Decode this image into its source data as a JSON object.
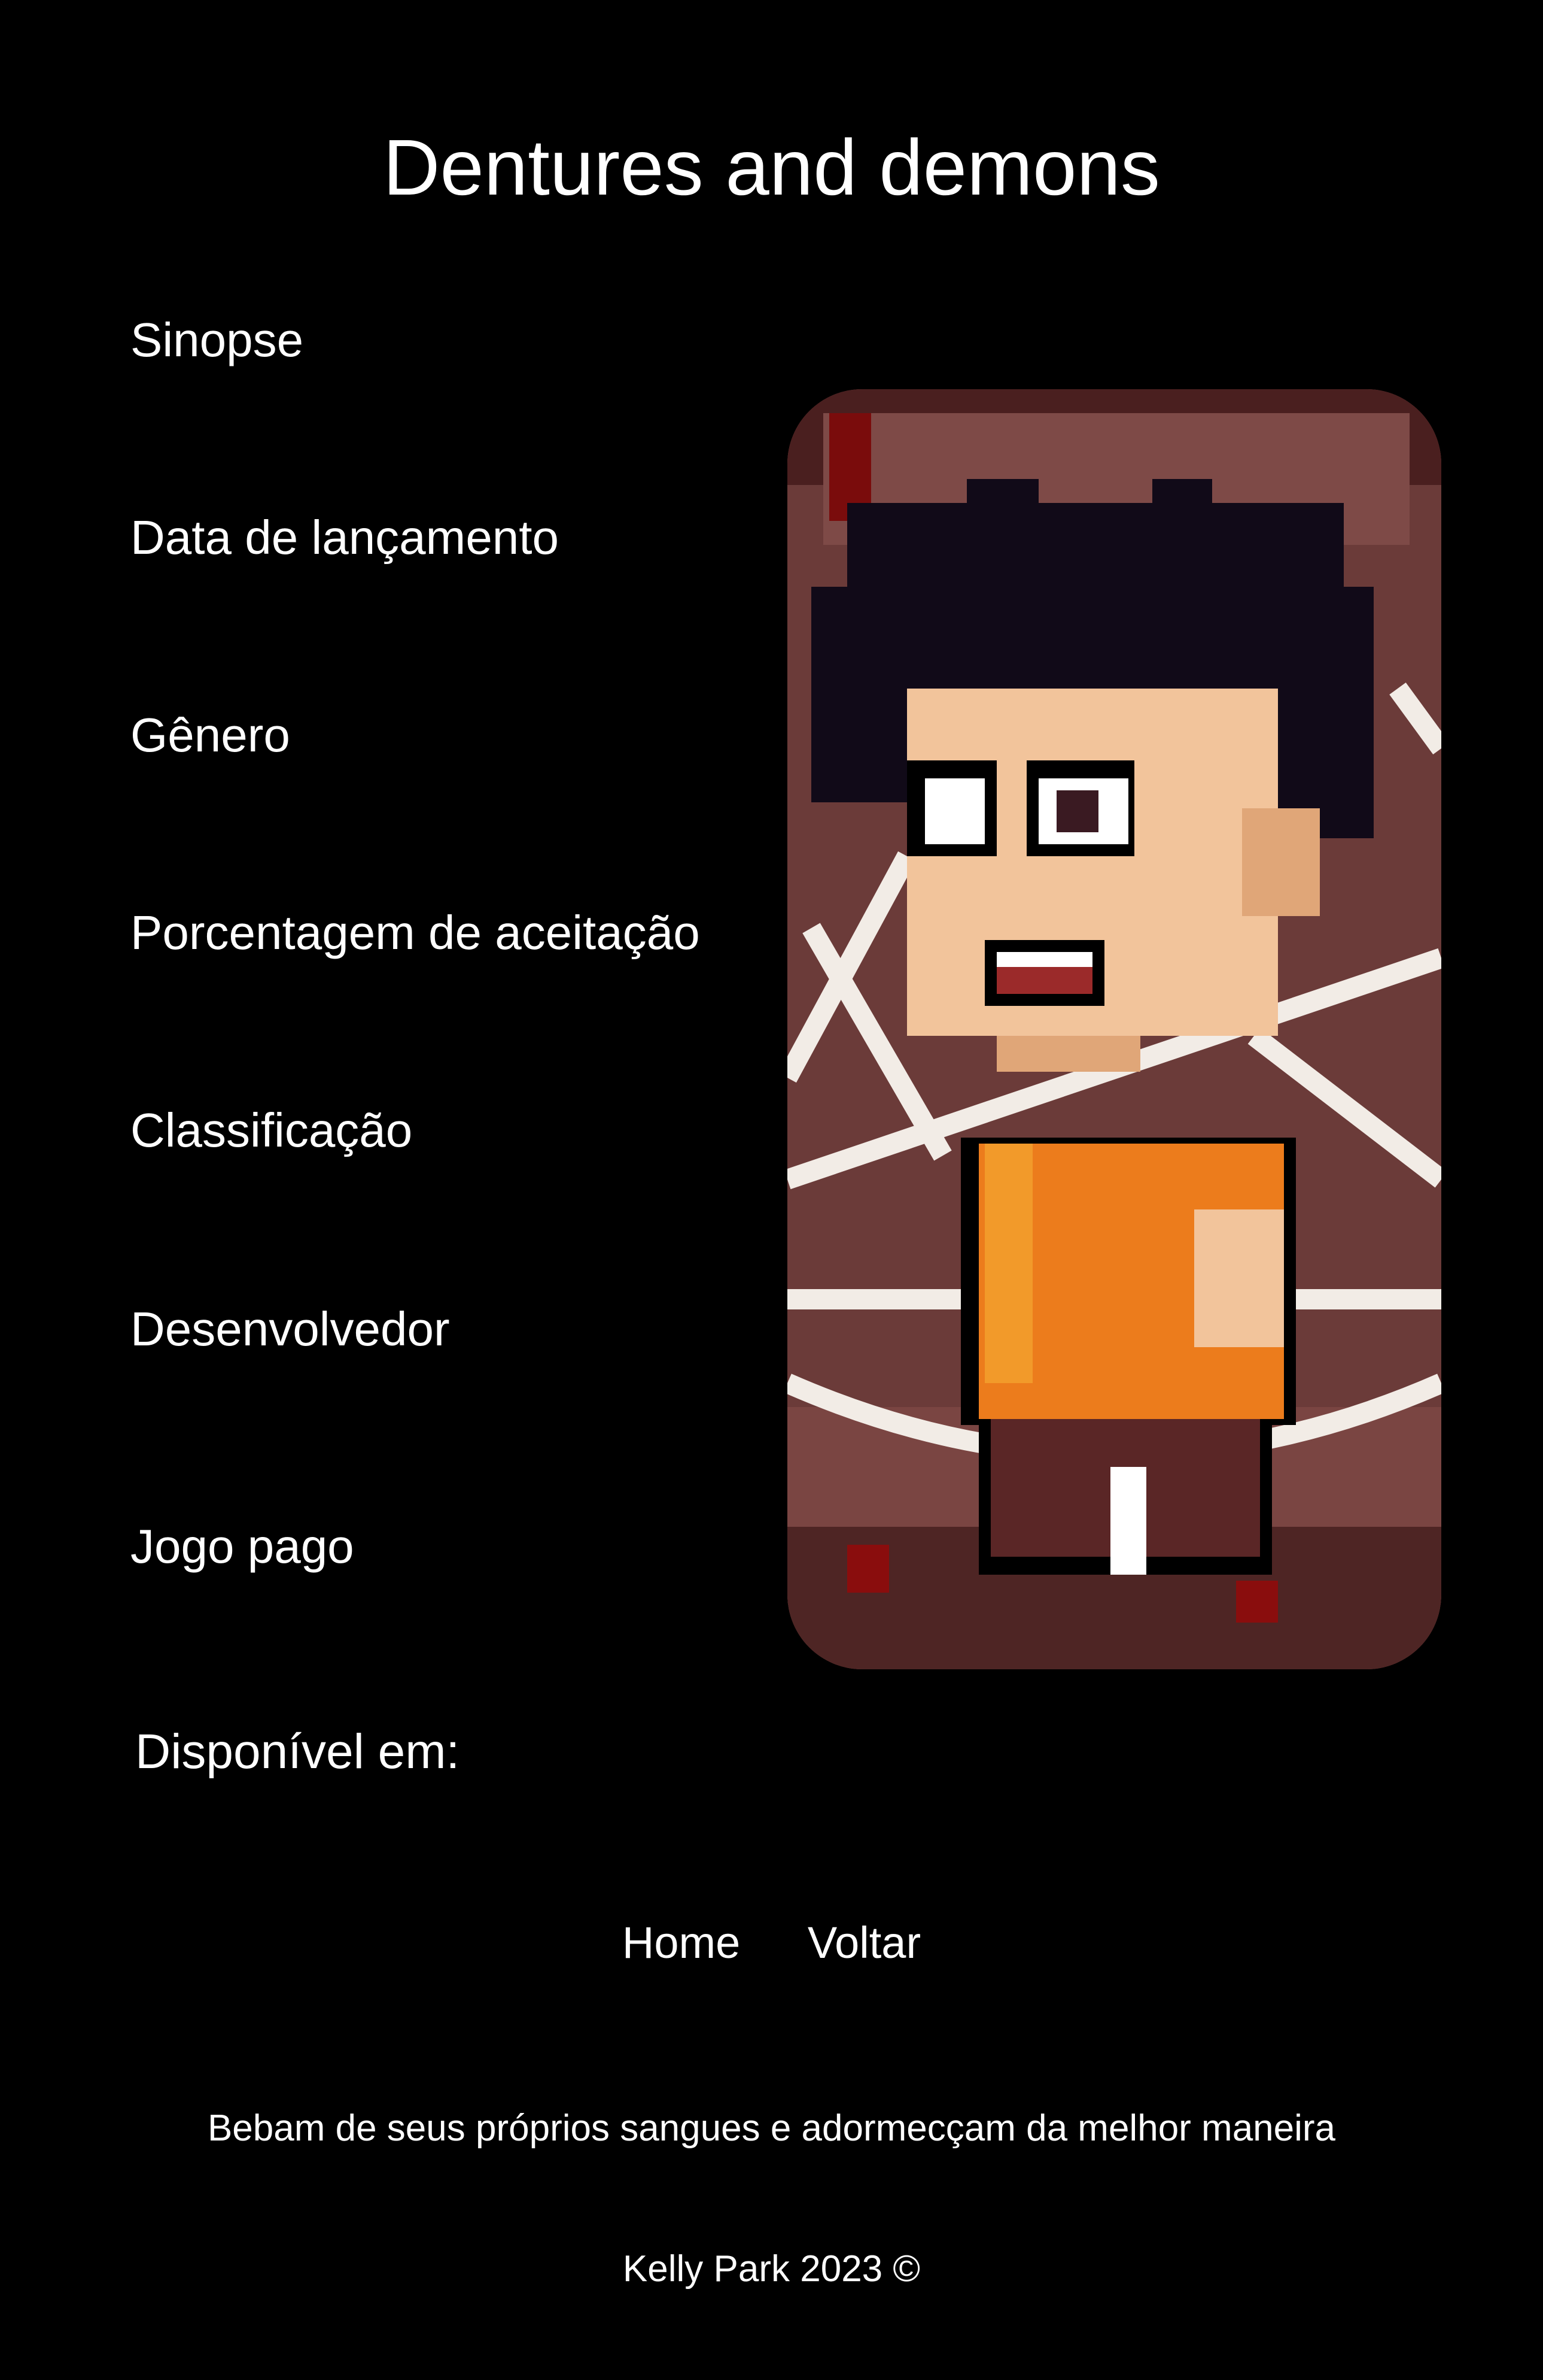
{
  "page": {
    "title": "Dentures and demons"
  },
  "details": {
    "synopsis": "Sinopse",
    "release_date": "Data de lançamento",
    "genre": "Gênero",
    "acceptance": "Porcentagem de aceitação",
    "rating": "Classificação",
    "developer": "Desenvolvedor",
    "paid": "Jogo pago",
    "available_on": "Disponível em:"
  },
  "nav": {
    "home": "Home",
    "back": "Voltar"
  },
  "footer": {
    "tagline": "Bebam de seus próprios sangues e adormecçam da melhor maneira",
    "copyright": "Kelly Park 2023 ©"
  },
  "colors": {
    "background": "#000000",
    "text": "#ffffff"
  },
  "cover": {
    "icon": "pixel-art-character"
  }
}
